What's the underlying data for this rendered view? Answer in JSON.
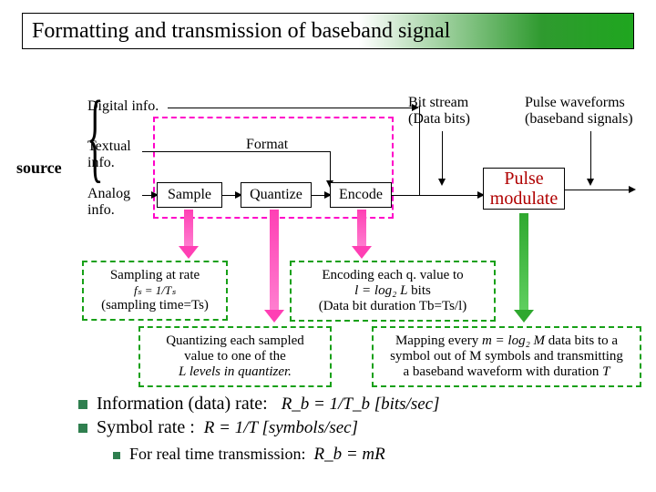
{
  "title": "Formatting and transmission of baseband signal",
  "source_label": "source",
  "sources": {
    "digital": "Digital info.",
    "textual": "Textual info.",
    "analog": "Analog info."
  },
  "format_label": "Format",
  "blocks": {
    "sample": "Sample",
    "quantize": "Quantize",
    "encode": "Encode",
    "pulse_l1": "Pulse",
    "pulse_l2": "modulate"
  },
  "labels": {
    "bitstream_l1": "Bit stream",
    "bitstream_l2": "(Data bits)",
    "pulsewave_l1": "Pulse waveforms",
    "pulsewave_l2": "(baseband signals)"
  },
  "notes": {
    "sampling_l1": "Sampling at rate",
    "sampling_eq": "fₛ = 1/Tₛ",
    "sampling_l2": "(sampling time=Ts)",
    "encoding_l1": "Encoding each q. value to",
    "encoding_eq": "l = log₂ L",
    "encoding_bits": " bits",
    "encoding_l2": "(Data bit duration Tb=Ts/l)",
    "quant_l1": "Quantizing each sampled",
    "quant_l2": "value to one of the",
    "quant_l3": "L levels in quantizer.",
    "map_pre": "Mapping every ",
    "map_eq": "m = log₂ M",
    "map_post1": " data bits to a",
    "map_l2": "symbol out of M symbols and transmitting",
    "map_l3_pre": "a baseband waveform with duration ",
    "map_l3_T": "T"
  },
  "bullets": {
    "info_rate": "Information (data) rate:",
    "info_rate_eq": "R_b = 1/T_b  [bits/sec]",
    "symbol_rate": "Symbol rate :",
    "symbol_rate_eq": "R = 1/T  [symbols/sec]",
    "realtime": "For real time transmission:",
    "realtime_eq": "R_b = mR"
  }
}
